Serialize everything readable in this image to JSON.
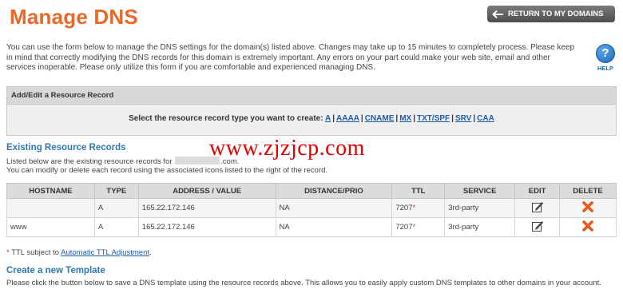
{
  "page": {
    "title": "Manage DNS",
    "return_label": "RETURN TO MY DOMAINS",
    "help_label": "HELP",
    "help_glyph": "?",
    "intro": "You can use the form below to manage the DNS settings for the domain(s) listed above. Changes may take up to 15 minutes to completely process. Please keep in mind that correctly modifying the DNS records for this domain is extremely important. Any errors on your part could make your web site, email and other services inoperable. Please only utilize this form if you are comfortable and experienced managing DNS."
  },
  "add_panel": {
    "heading": "Add/Edit a Resource Record",
    "prompt": "Select the resource record type you want to create:",
    "types": [
      "A",
      "AAAA",
      "CNAME",
      "MX",
      "TXT/SPF",
      "SRV",
      "CAA"
    ]
  },
  "existing": {
    "heading": "Existing Resource Records",
    "line1_before": "Listed below are the existing resource records for",
    "line1_after": ".com.",
    "line2": "You can modify or delete each record using the associated icons listed to the right of the record.",
    "columns": [
      "HOSTNAME",
      "TYPE",
      "ADDRESS / VALUE",
      "DISTANCE/PRIO",
      "TTL",
      "SERVICE",
      "EDIT",
      "DELETE"
    ],
    "rows": [
      {
        "hostname": "",
        "type": "A",
        "address": "165.22.172.146",
        "distance": "NA",
        "ttl": "7207",
        "service": "3rd-party"
      },
      {
        "hostname": "www",
        "type": "A",
        "address": "165.22.172.146",
        "distance": "NA",
        "ttl": "7207",
        "service": "3rd-party"
      }
    ],
    "ttl_marker": "*"
  },
  "footnote": {
    "star": "*",
    "text": " TTL subject to ",
    "link": "Automatic TTL Adjustment",
    "end": "."
  },
  "template": {
    "heading": "Create a new Template",
    "text": "Please click the button below to save a DNS template using the resource records above. This allows you to easily apply custom DNS templates to other domains in your account."
  },
  "watermark": "www.zjzjcp.com",
  "colors": {
    "title": "#e8692a",
    "link": "#1c5ea8",
    "heading": "#2f77b5",
    "delete_icon": "#e85a1c",
    "watermark": "#e00000"
  },
  "icons": {
    "return": "arrow-left-icon",
    "help": "question-circle-icon",
    "edit": "pencil-edit-icon",
    "delete": "x-delete-icon"
  }
}
